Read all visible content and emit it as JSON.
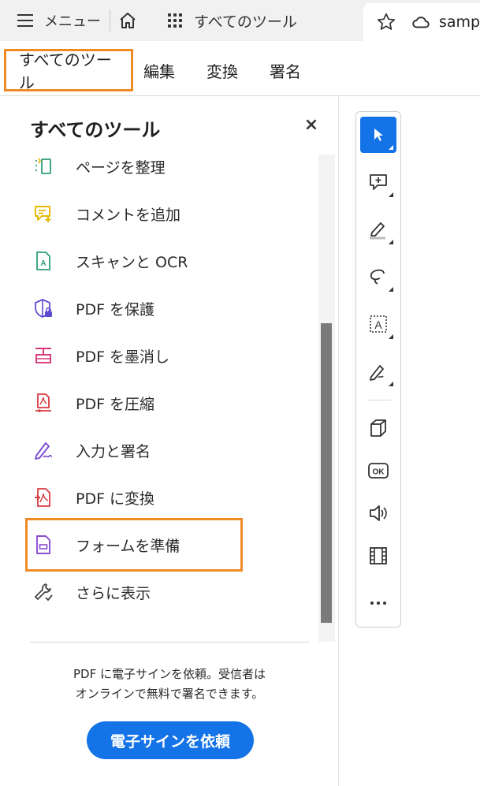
{
  "topbar": {
    "menu_label": "メニュー",
    "tools_label": "すべてのツール",
    "doc_tab_label": "samp"
  },
  "subnav": {
    "tabs": [
      {
        "label": "すべてのツール"
      },
      {
        "label": "編集"
      },
      {
        "label": "変換"
      },
      {
        "label": "署名"
      }
    ]
  },
  "panel": {
    "title": "すべてのツール",
    "close_label": "×",
    "tools": [
      {
        "label": "ページを整理",
        "icon": "organize-pages-icon",
        "color": "#2d9d78"
      },
      {
        "label": "コメントを追加",
        "icon": "add-comment-icon",
        "color": "#e6b800"
      },
      {
        "label": "スキャンと OCR",
        "icon": "scan-ocr-icon",
        "color": "#2d9d78"
      },
      {
        "label": "PDF を保護",
        "icon": "protect-pdf-icon",
        "color": "#5b4bd1"
      },
      {
        "label": "PDF を墨消し",
        "icon": "redact-pdf-icon",
        "color": "#d9367c"
      },
      {
        "label": "PDF を圧縮",
        "icon": "compress-pdf-icon",
        "color": "#d7373f"
      },
      {
        "label": "入力と署名",
        "icon": "fill-sign-icon",
        "color": "#7b4bd1"
      },
      {
        "label": "PDF に変換",
        "icon": "convert-pdf-icon",
        "color": "#d7373f"
      },
      {
        "label": "フォームを準備",
        "icon": "prepare-form-icon",
        "color": "#8a4bd1"
      },
      {
        "label": "さらに表示",
        "icon": "wrench-icon",
        "color": "#444444"
      }
    ],
    "promo_line1": "PDF に電子サインを依頼。受信者は",
    "promo_line2": "オンラインで無料で署名できます。",
    "promo_button": "電子サインを依頼"
  },
  "colors": {
    "accent": "#1473e6",
    "highlight": "#f08a25"
  }
}
